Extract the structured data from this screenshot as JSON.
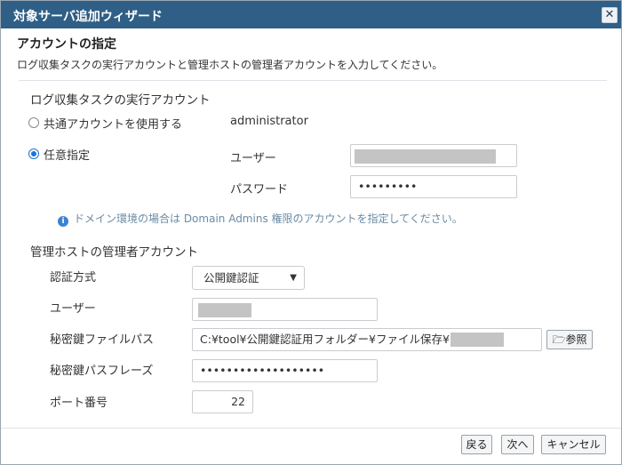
{
  "window": {
    "title": "対象サーバ追加ウィザード",
    "close_glyph": "✕"
  },
  "header": {
    "title": "アカウントの指定",
    "description": "ログ収集タスクの実行アカウントと管理ホストの管理者アカウントを入力してください。"
  },
  "task_account": {
    "section_label": "ログ収集タスクの実行アカウント",
    "shared_option_label": "共通アカウントを使用する",
    "shared_account_value": "administrator",
    "custom_option_label": "任意指定",
    "user_label": "ユーザー",
    "user_value": "",
    "password_label": "パスワード",
    "password_value": "•••••••••",
    "info_icon": "i",
    "info_text": "ドメイン環境の場合は Domain Admins 権限のアカウントを指定してください。"
  },
  "admin_account": {
    "section_label": "管理ホストの管理者アカウント",
    "auth_method_label": "認証方式",
    "auth_method_value": "公開鍵認証",
    "user_label": "ユーザー",
    "user_value": "",
    "key_path_label": "秘密鍵ファイルパス",
    "key_path_value": "C:¥tool¥公開鍵認証用フォルダー¥ファイル保存¥",
    "browse_label": "参照",
    "passphrase_label": "秘密鍵パスフレーズ",
    "passphrase_value": "•••••••••••••••••••",
    "port_label": "ポート番号",
    "port_value": "22"
  },
  "footer": {
    "back_label": "戻る",
    "next_label": "次へ",
    "cancel_label": "キャンセル"
  },
  "colors": {
    "titlebar": "#2f5f86",
    "accent": "#1976d2",
    "info": "#6b8aa3",
    "redaction": "#c4c4c4"
  }
}
